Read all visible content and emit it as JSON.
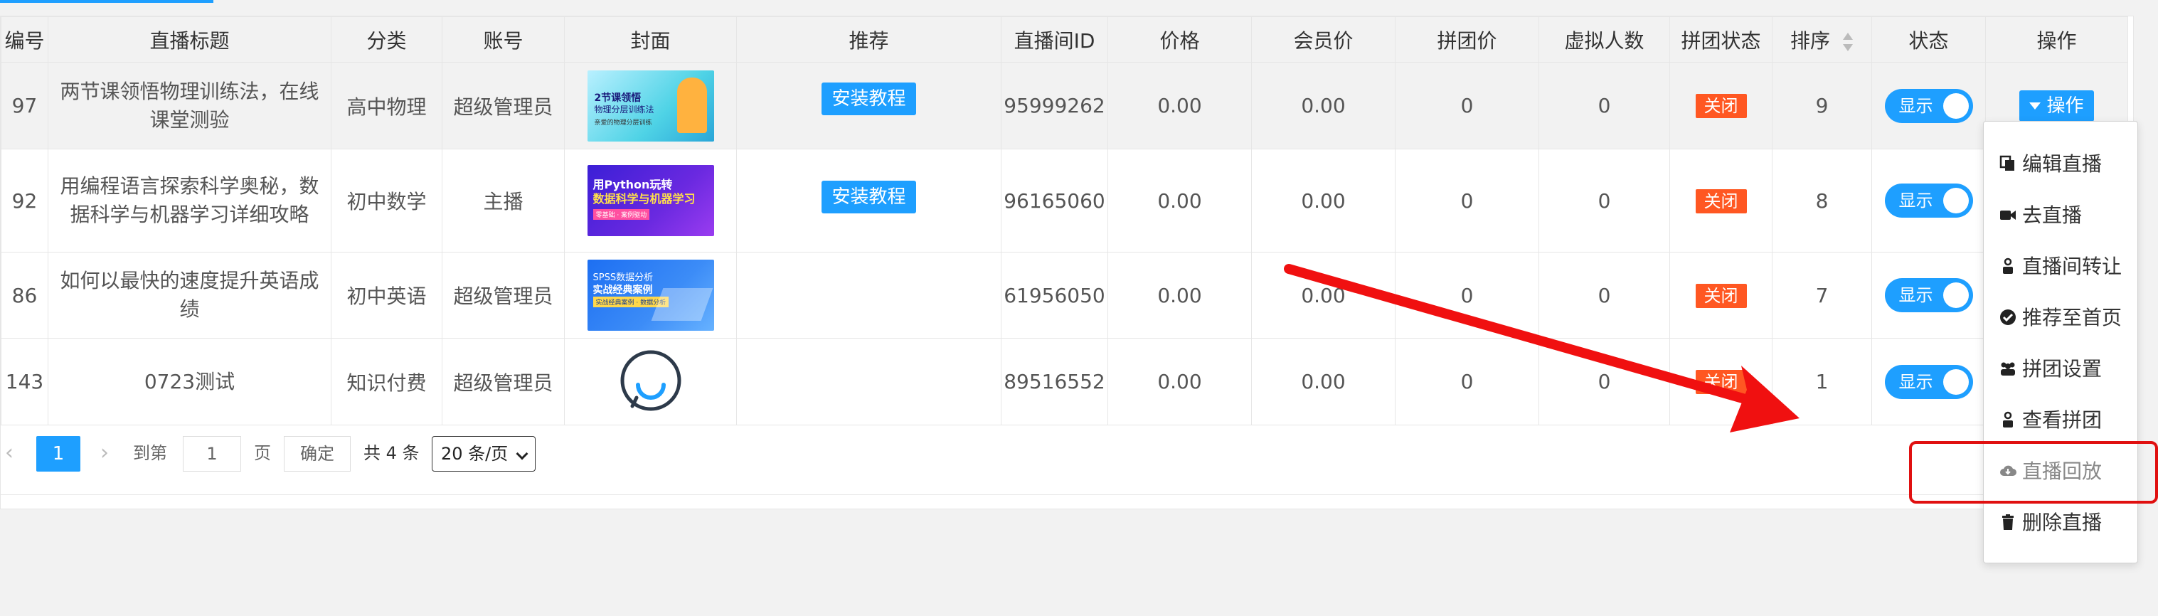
{
  "table": {
    "headers": {
      "id": "编号",
      "title": "直播标题",
      "category": "分类",
      "account": "账号",
      "cover": "封面",
      "recommend": "推荐",
      "room_id": "直播间ID",
      "price": "价格",
      "member_price": "会员价",
      "group_price": "拼团价",
      "virtual": "虚拟人数",
      "group_status": "拼团状态",
      "sort": "排序",
      "status": "状态",
      "action": "操作"
    },
    "rows": [
      {
        "id": "97",
        "title": "两节课领悟物理训练法，在线课堂测验",
        "category": "高中物理",
        "account": "超级管理员",
        "cover": {
          "line1": "2节课领悟",
          "line2": "物理分层训练法",
          "line3": "亲爱的物理分层训练"
        },
        "recommend": "安装教程",
        "room_id": "95999262",
        "price": "0.00",
        "member_price": "0.00",
        "group_price": "0",
        "virtual": "0",
        "group_status": "关闭",
        "sort": "9",
        "status": "显示",
        "action": "操作"
      },
      {
        "id": "92",
        "title": "用编程语言探索科学奥秘，数据科学与机器学习详细攻略",
        "category": "初中数学",
        "account": "主播",
        "cover": {
          "line1": "用Python玩转",
          "line2": "数据科学与机器学习",
          "line3": "零基础 · 案例驱动"
        },
        "recommend": "安装教程",
        "room_id": "96165060",
        "price": "0.00",
        "member_price": "0.00",
        "group_price": "0",
        "virtual": "0",
        "group_status": "关闭",
        "sort": "8",
        "status": "显示"
      },
      {
        "id": "86",
        "title": "如何以最快的速度提升英语成绩",
        "category": "初中英语",
        "account": "超级管理员",
        "cover": {
          "line1": "SPSS数据分析",
          "line2": "实战经典案例",
          "line3": "实战经典案例 · 数据分析"
        },
        "recommend": "",
        "room_id": "61956050",
        "price": "0.00",
        "member_price": "0.00",
        "group_price": "0",
        "virtual": "0",
        "group_status": "关闭",
        "sort": "7",
        "status": "显示"
      },
      {
        "id": "143",
        "title": "0723测试",
        "category": "知识付费",
        "account": "超级管理员",
        "recommend": "",
        "room_id": "89516552",
        "price": "0.00",
        "member_price": "0.00",
        "group_price": "0",
        "virtual": "0",
        "group_status": "关闭",
        "sort": "1",
        "status": "显示"
      }
    ]
  },
  "pager": {
    "current_page": "1",
    "goto_label": "到第",
    "goto_value": "1",
    "page_unit": "页",
    "confirm": "确定",
    "total": "共 4 条",
    "page_size": "20 条/页"
  },
  "dropdown": {
    "items": [
      {
        "label": "编辑直播",
        "icon": "copy-icon"
      },
      {
        "label": "去直播",
        "icon": "video-camera-icon"
      },
      {
        "label": "直播间转让",
        "icon": "user-icon"
      },
      {
        "label": "推荐至首页",
        "icon": "check-circle-icon"
      },
      {
        "label": "拼团设置",
        "icon": "users-icon"
      },
      {
        "label": "查看拼团",
        "icon": "user-icon"
      },
      {
        "label": "直播回放",
        "icon": "cloud-download-icon"
      },
      {
        "label": "删除直播",
        "icon": "trash-icon"
      }
    ]
  },
  "colors": {
    "accent": "#1E9FFF",
    "badge_red": "#FF5722",
    "annotation_red": "#E01010"
  }
}
